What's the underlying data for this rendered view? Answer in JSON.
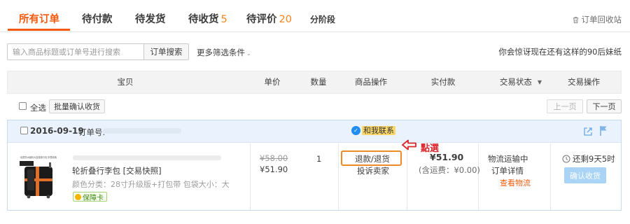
{
  "tabs": [
    {
      "label": "所有订单",
      "count": ""
    },
    {
      "label": "待付款",
      "count": ""
    },
    {
      "label": "待发货",
      "count": ""
    },
    {
      "label": "待收货",
      "count": "5"
    },
    {
      "label": "待评价",
      "count": "20"
    },
    {
      "label": "分阶段",
      "count": ""
    }
  ],
  "recycle_bin": "订单回收站",
  "search": {
    "placeholder": "输入商品标题或订单号进行搜索",
    "button": "订单搜索",
    "more_filters": "更多筛选条件"
  },
  "hint": "你会惊讶现在还有这样的90后妹纸",
  "table_headers": [
    "宝贝",
    "单价",
    "数量",
    "商品操作",
    "实付款",
    "交易状态",
    "交易操作"
  ],
  "select_all": "全选",
  "batch_confirm": "批量确认收货",
  "pagination": {
    "prev": "上一页",
    "next": "下一页"
  },
  "order": {
    "date": "2016-09-19",
    "order_no_label": "订单号:",
    "contact_label": "和我联系",
    "product": {
      "title": "轮折叠行李包 [交易快照]",
      "spec": "颜色分类：28寸升级版+打包带   包袋大小：大",
      "guarantee": "保障卡",
      "image_label": "优质防水面料大容量旅行包 折叠收纳"
    },
    "price_original": "¥58.00",
    "price_now": "¥51.90",
    "quantity": "1",
    "actions": {
      "refund": "退款/退货",
      "complain": "投诉卖家"
    },
    "click_note": "點選",
    "paid": "¥51.90",
    "freight": "(含运费：¥0.00)",
    "status": [
      "物流运输中",
      "订单详情",
      "查看物流"
    ],
    "remaining": "还剩9天5时",
    "confirm_button": "确认收货"
  },
  "colors": {
    "accent": "#f25a0d",
    "annotation": "#ef8a28",
    "note_red": "#d9262c",
    "order_head_bg": "#eaf3fd",
    "confirm_bg": "#a9d4f5"
  }
}
